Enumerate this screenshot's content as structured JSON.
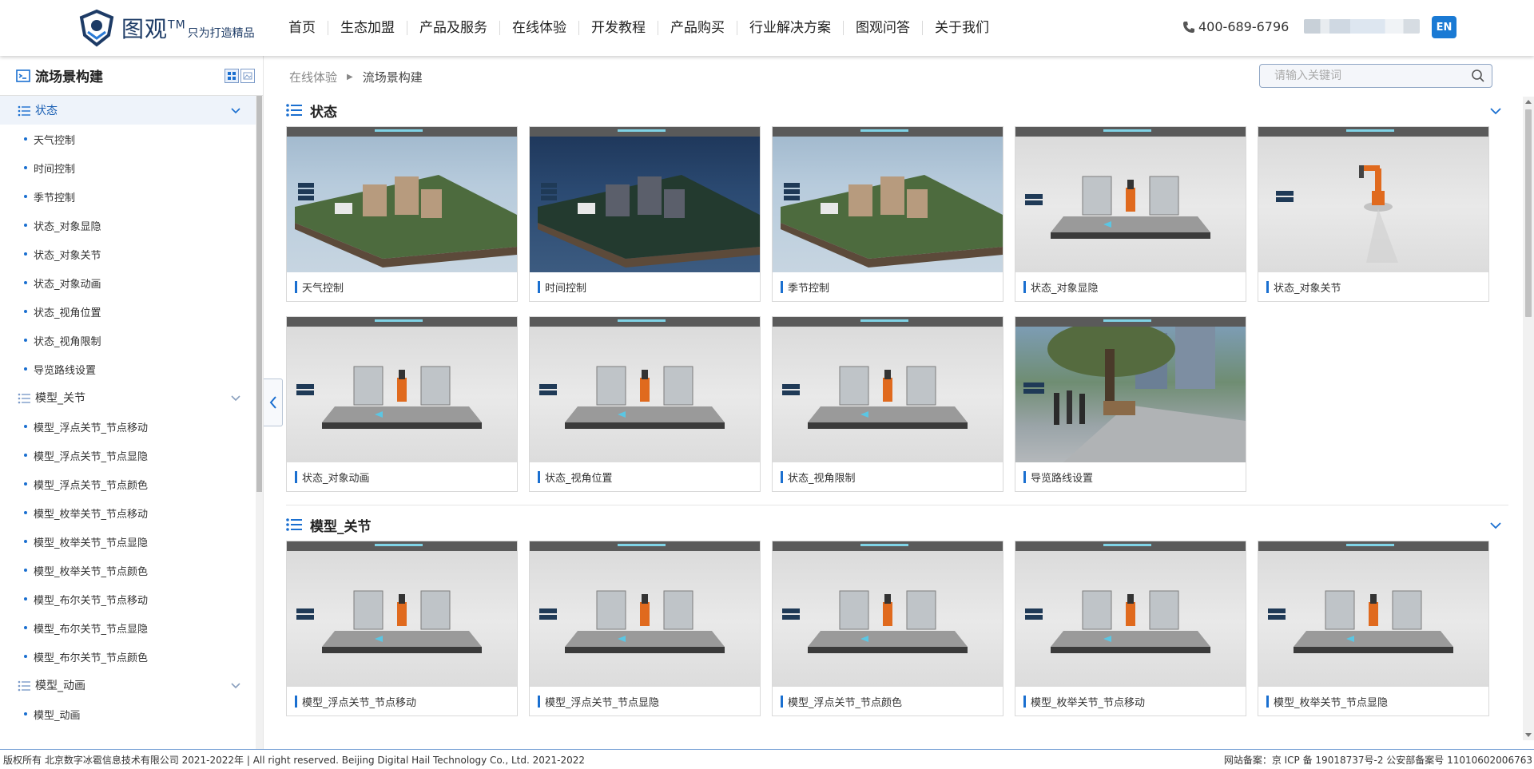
{
  "header": {
    "logo_text": "图观",
    "logo_tm": "TM",
    "logo_slogan": "只为打造精品",
    "nav": [
      "首页",
      "生态加盟",
      "产品及服务",
      "在线体验",
      "开发教程",
      "产品购买",
      "行业解决方案",
      "图观问答",
      "关于我们"
    ],
    "phone": "400-689-6796",
    "lang_button": "EN"
  },
  "sidebar": {
    "title": "流场景构建",
    "groups": [
      {
        "label": "状态",
        "expanded": true,
        "items": [
          "天气控制",
          "时间控制",
          "季节控制",
          "状态_对象显隐",
          "状态_对象关节",
          "状态_对象动画",
          "状态_视角位置",
          "状态_视角限制",
          "导览路线设置"
        ]
      },
      {
        "label": "模型_关节",
        "expanded": true,
        "items": [
          "模型_浮点关节_节点移动",
          "模型_浮点关节_节点显隐",
          "模型_浮点关节_节点颜色",
          "模型_枚举关节_节点移动",
          "模型_枚举关节_节点显隐",
          "模型_枚举关节_节点颜色",
          "模型_布尔关节_节点移动",
          "模型_布尔关节_节点显隐",
          "模型_布尔关节_节点颜色"
        ]
      },
      {
        "label": "模型_动画",
        "expanded": true,
        "items": [
          "模型_动画"
        ]
      }
    ]
  },
  "breadcrumb": {
    "parent": "在线体验",
    "current": "流场景构建"
  },
  "search": {
    "placeholder": "请输入关键词"
  },
  "sections": [
    {
      "title": "状态",
      "cards": [
        {
          "label": "天气控制",
          "scene": "city"
        },
        {
          "label": "时间控制",
          "scene": "night"
        },
        {
          "label": "季节控制",
          "scene": "city"
        },
        {
          "label": "状态_对象显隐",
          "scene": "room"
        },
        {
          "label": "状态_对象关节",
          "scene": "arm"
        },
        {
          "label": "状态_对象动画",
          "scene": "room"
        },
        {
          "label": "状态_视角位置",
          "scene": "room"
        },
        {
          "label": "状态_视角限制",
          "scene": "room"
        },
        {
          "label": "导览路线设置",
          "scene": "park"
        }
      ]
    },
    {
      "title": "模型_关节",
      "cards": [
        {
          "label": "模型_浮点关节_节点移动",
          "scene": "room"
        },
        {
          "label": "模型_浮点关节_节点显隐",
          "scene": "room"
        },
        {
          "label": "模型_浮点关节_节点颜色",
          "scene": "room"
        },
        {
          "label": "模型_枚举关节_节点移动",
          "scene": "room"
        },
        {
          "label": "模型_枚举关节_节点显隐",
          "scene": "room"
        }
      ]
    }
  ],
  "footer": {
    "left": "版权所有 北京数字冰雹信息技术有限公司 2021-2022年 | All right reserved. Beijing Digital Hail Technology Co., Ltd. 2021-2022",
    "right": "网站备案：京 ICP 备 19018737号-2 公安部备案号 11010602006763"
  },
  "colors": {
    "accent": "#1a6fd0",
    "brand": "#1d3b66",
    "en_button": "#1a7ad4"
  }
}
